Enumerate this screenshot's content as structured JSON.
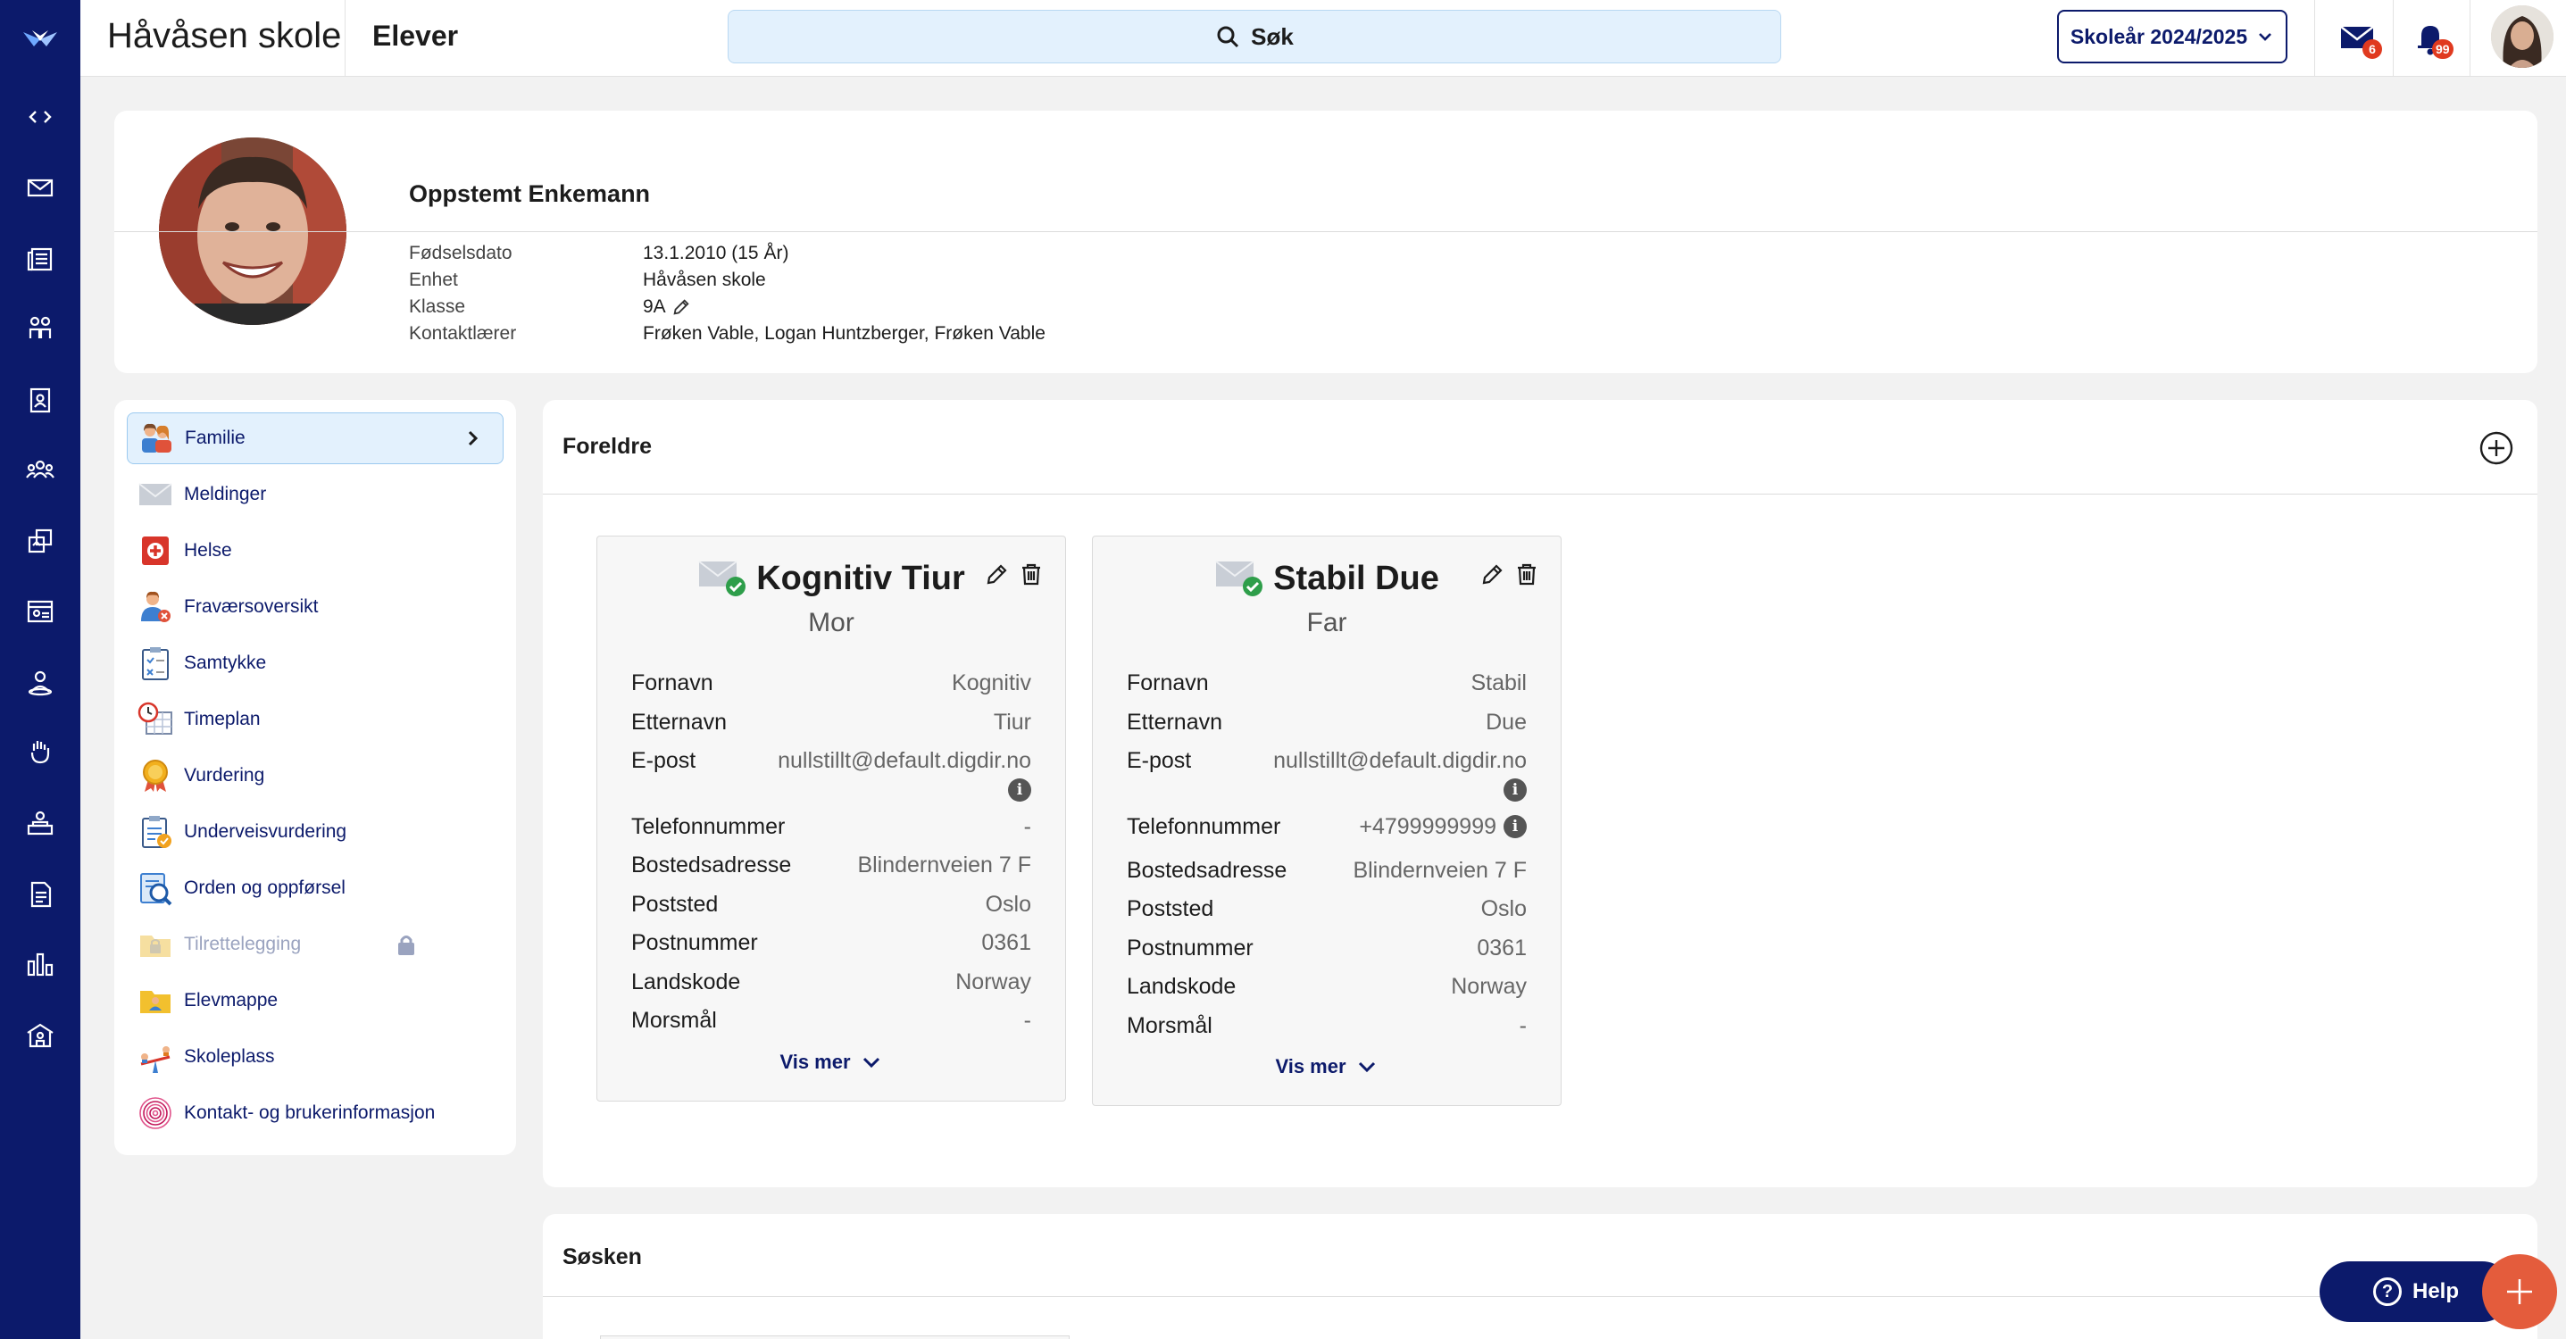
{
  "app": {
    "school_name": "Håvåsen skole",
    "page_name": "Elever",
    "search_label": "Søk",
    "school_year": "Skoleår 2024/2025",
    "mail_badge": "6",
    "notification_badge": "99"
  },
  "rail": {
    "icons": [
      "code-icon",
      "mail-icon",
      "news-icon",
      "people-icon",
      "badge-icon",
      "group-icon",
      "swap-icon",
      "calendar-icon",
      "user-pin-icon",
      "hand-icon",
      "classroom-icon",
      "document-icon",
      "chart-icon",
      "school-icon"
    ]
  },
  "student": {
    "name": "Oppstemt Enkemann",
    "fields": [
      {
        "label": "Fødselsdato",
        "value": "13.1.2010 (15 År)"
      },
      {
        "label": "Enhet",
        "value": "Håvåsen skole"
      },
      {
        "label": "Klasse",
        "value": "9A"
      },
      {
        "label": "Kontaktlærer",
        "value": "Frøken Vable, Logan Huntzberger, Frøken Vable"
      }
    ]
  },
  "menu": {
    "items": [
      {
        "label": "Familie",
        "icon": "family-icon"
      },
      {
        "label": "Meldinger",
        "icon": "envelope-icon"
      },
      {
        "label": "Helse",
        "icon": "health-icon"
      },
      {
        "label": "Fraværsoversikt",
        "icon": "absence-icon"
      },
      {
        "label": "Samtykke",
        "icon": "consent-icon"
      },
      {
        "label": "Timeplan",
        "icon": "timetable-icon"
      },
      {
        "label": "Vurdering",
        "icon": "medal-icon"
      },
      {
        "label": "Underveisvurdering",
        "icon": "assessment-icon"
      },
      {
        "label": "Orden og oppførsel",
        "icon": "conduct-icon"
      },
      {
        "label": "Tilrettelegging",
        "icon": "folder-lock-icon"
      },
      {
        "label": "Elevmappe",
        "icon": "student-folder-icon"
      },
      {
        "label": "Skoleplass",
        "icon": "seesaw-icon"
      },
      {
        "label": "Kontakt- og brukerinformasjon",
        "icon": "fingerprint-icon"
      }
    ]
  },
  "parents": {
    "title": "Foreldre",
    "cards": [
      {
        "name": "Kognitiv Tiur",
        "role": "Mor",
        "rows": [
          {
            "k": "Fornavn",
            "v": "Kognitiv"
          },
          {
            "k": "Etternavn",
            "v": "Tiur"
          },
          {
            "k": "E-post",
            "v": "nullstillt@default.digdir.no"
          },
          {
            "k": "Telefonnummer",
            "v": "-"
          },
          {
            "k": "Bostedsadresse",
            "v": "Blindernveien 7 F"
          },
          {
            "k": "Poststed",
            "v": "Oslo"
          },
          {
            "k": "Postnummer",
            "v": "0361"
          },
          {
            "k": "Landskode",
            "v": "Norway"
          },
          {
            "k": "Morsmål",
            "v": "-"
          }
        ],
        "more_label": "Vis mer"
      },
      {
        "name": "Stabil Due",
        "role": "Far",
        "rows": [
          {
            "k": "Fornavn",
            "v": "Stabil"
          },
          {
            "k": "Etternavn",
            "v": "Due"
          },
          {
            "k": "E-post",
            "v": "nullstillt@default.digdir.no"
          },
          {
            "k": "Telefonnummer",
            "v": "+4799999999"
          },
          {
            "k": "Bostedsadresse",
            "v": "Blindernveien 7 F"
          },
          {
            "k": "Poststed",
            "v": "Oslo"
          },
          {
            "k": "Postnummer",
            "v": "0361"
          },
          {
            "k": "Landskode",
            "v": "Norway"
          },
          {
            "k": "Morsmål",
            "v": "-"
          }
        ],
        "more_label": "Vis mer"
      }
    ]
  },
  "siblings": {
    "title": "Søsken"
  },
  "help": {
    "label": "Help"
  },
  "colors": {
    "navy": "#0c1a6b",
    "accent": "#e45c3c",
    "search_bg": "#e3f1fd"
  }
}
